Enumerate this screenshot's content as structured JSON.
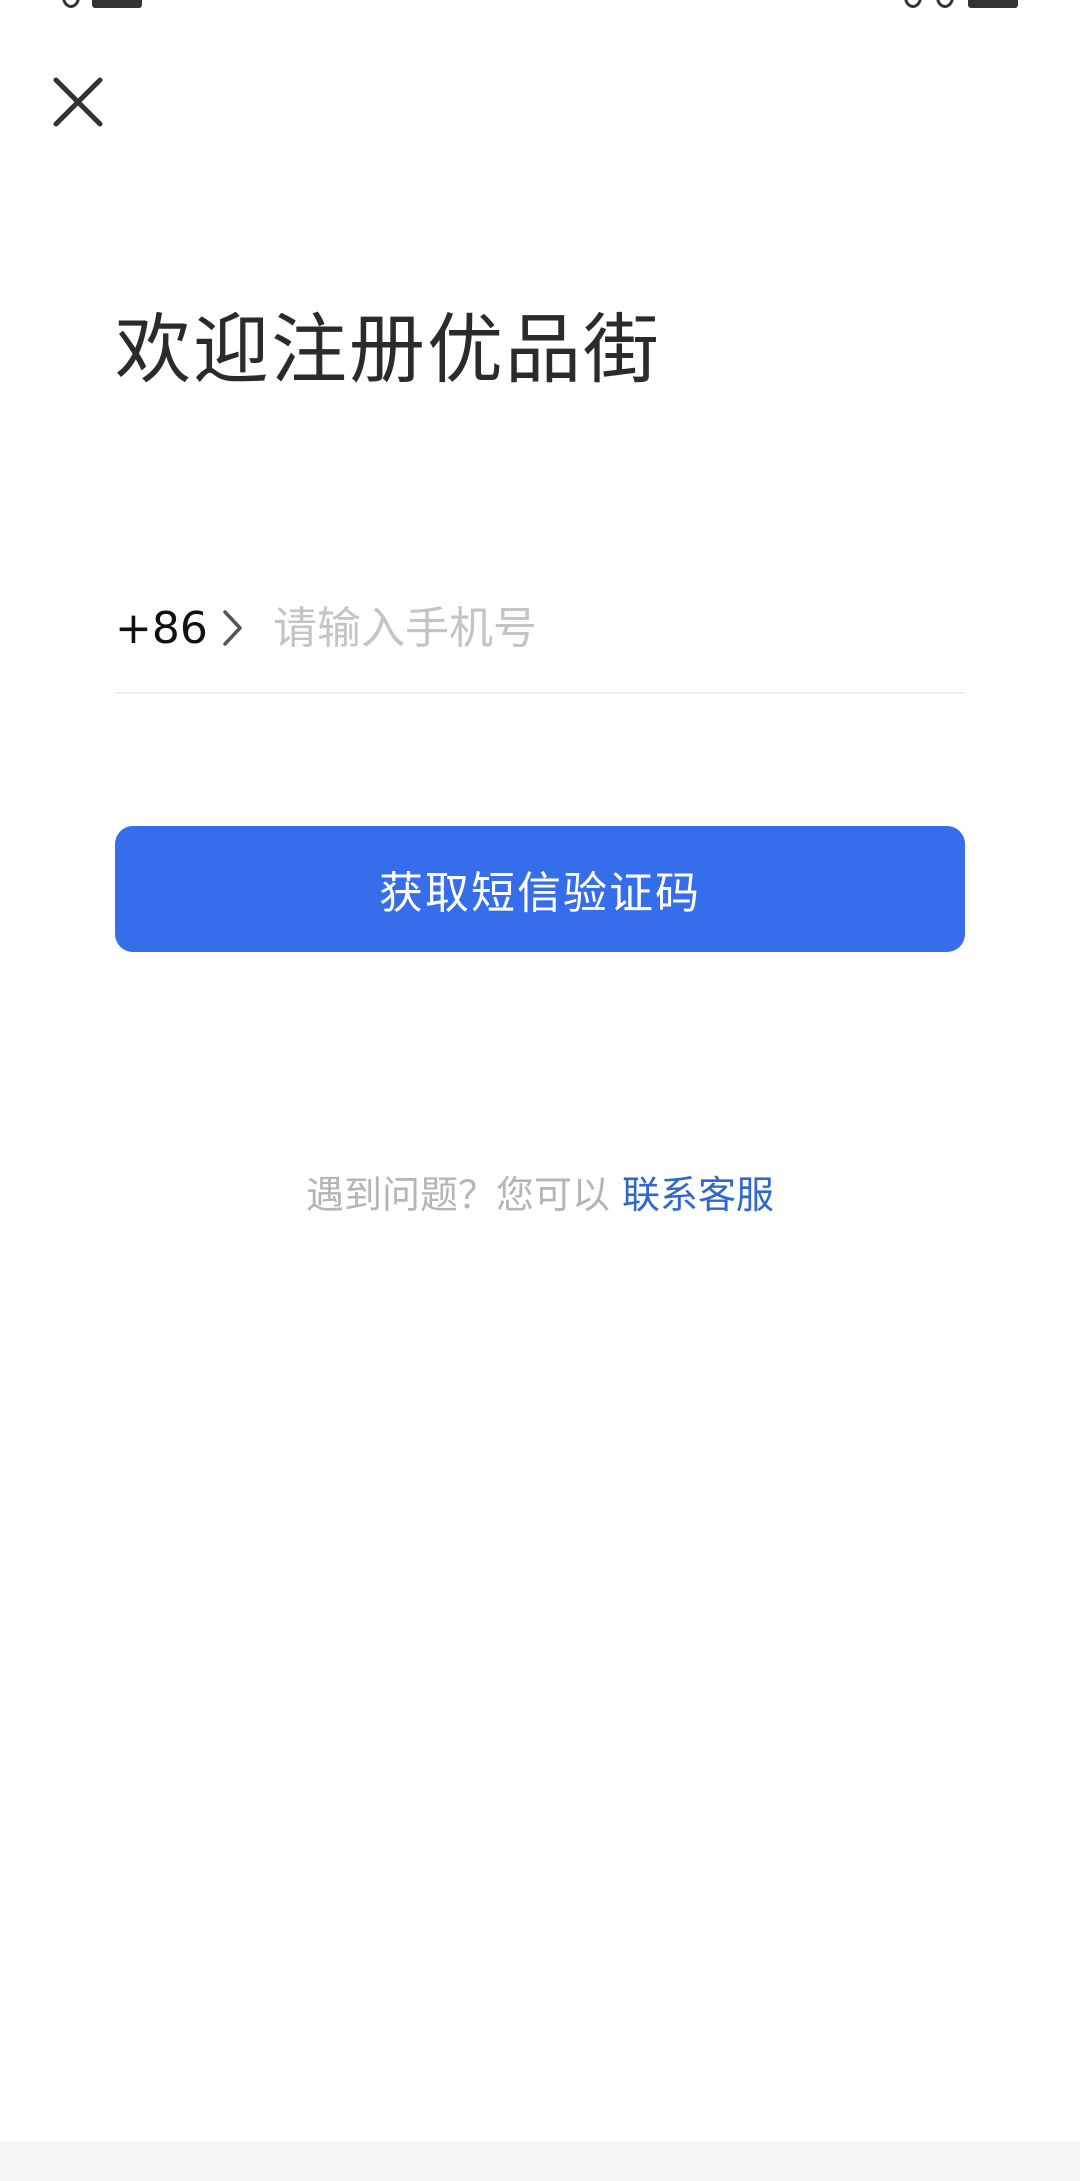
{
  "header": {
    "close_icon": "close-icon"
  },
  "title": "欢迎注册优品街",
  "phone": {
    "country_code": "+86",
    "chevron_icon": "chevron-right-icon",
    "placeholder": "请输入手机号",
    "value": ""
  },
  "sms_button_label": "获取短信验证码",
  "help": {
    "text": "遇到问题？您可以",
    "link_label": "联系客服"
  },
  "colors": {
    "primary": "#356deb",
    "link": "#2f66cf",
    "placeholder": "#c4c4c4",
    "muted_text": "#b5b5b5"
  }
}
